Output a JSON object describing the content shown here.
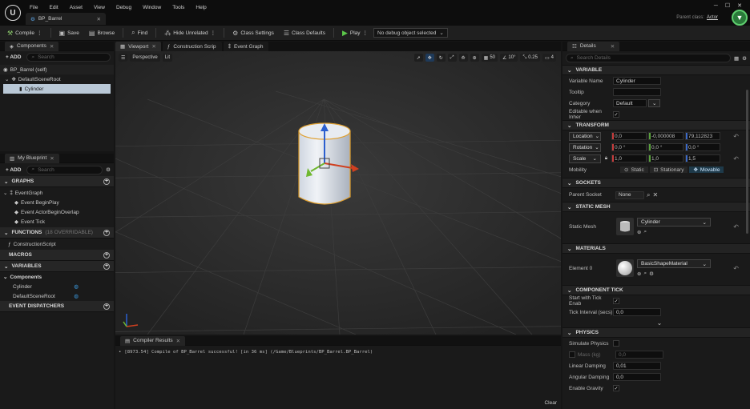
{
  "menu": [
    "File",
    "Edit",
    "Asset",
    "View",
    "Debug",
    "Window",
    "Tools",
    "Help"
  ],
  "tab": {
    "title": "BP_Barrel"
  },
  "window": {
    "parent_label": "Parent class:",
    "parent_value": "Actor"
  },
  "toolbar": {
    "compile": "Compile",
    "save": "Save",
    "browse": "Browse",
    "find": "Find",
    "hide_unrelated": "Hide Unrelated",
    "class_settings": "Class Settings",
    "class_defaults": "Class Defaults",
    "play": "Play",
    "debug_object": "No debug object selected"
  },
  "components": {
    "tab": "Components",
    "add": "+ ADD",
    "search_placeholder": "Search",
    "root": "BP_Barrel (self)",
    "scene_root": "DefaultSceneRoot",
    "cylinder": "Cylinder"
  },
  "myblueprint": {
    "tab": "My Blueprint",
    "add": "+ ADD",
    "search_placeholder": "Search",
    "graphs": "GRAPHS",
    "event_graph": "EventGraph",
    "events": [
      "Event BeginPlay",
      "Event ActorBeginOverlap",
      "Event Tick"
    ],
    "functions": "FUNCTIONS",
    "functions_sub": "(18 OVERRIDABLE)",
    "construction_script": "ConstructionScript",
    "macros": "MACROS",
    "variables": "VARIABLES",
    "components_group": "Components",
    "var_cylinder": "Cylinder",
    "var_scene_root": "DefaultSceneRoot",
    "dispatchers": "EVENT DISPATCHERS"
  },
  "editor_tabs": {
    "viewport": "Viewport",
    "construction": "Construction Scrip",
    "event_graph": "Event Graph"
  },
  "viewport": {
    "perspective": "Perspective",
    "lit": "Lit",
    "grid_snap": "50",
    "rot_snap": "10°",
    "scale_snap": "0.25",
    "cam_speed": "4"
  },
  "compiler": {
    "tab": "Compiler Results",
    "message": "[8973.54] Compile of BP_Barrel successful! [in 36 ms] (/Game/Blueprints/BP_Barrel.BP_Barrel)",
    "clear": "Clear"
  },
  "details": {
    "tab": "Details",
    "search_placeholder": "Search Details",
    "variable": {
      "header": "VARIABLE",
      "name_label": "Variable Name",
      "name_value": "Cylinder",
      "tooltip_label": "Tooltip",
      "tooltip_value": "",
      "category_label": "Category",
      "category_value": "Default",
      "editable_label": "Editable when Inher"
    },
    "transform": {
      "header": "TRANSFORM",
      "location": "Location",
      "rotation": "Rotation",
      "scale": "Scale",
      "loc": [
        "0,0",
        "-0,000008",
        "79,112823"
      ],
      "rot": [
        "0,0 °",
        "0,0 °",
        "0,0 °"
      ],
      "scl": [
        "1,0",
        "1,0",
        "1,5"
      ],
      "mobility": "Mobility",
      "static": "Static",
      "stationary": "Stationary",
      "movable": "Movable"
    },
    "sockets": {
      "header": "SOCKETS",
      "parent_label": "Parent Socket",
      "parent_value": "None"
    },
    "static_mesh": {
      "header": "STATIC MESH",
      "label": "Static Mesh",
      "value": "Cylinder"
    },
    "materials": {
      "header": "MATERIALS",
      "label": "Element 0",
      "value": "BasicShapeMaterial"
    },
    "component_tick": {
      "header": "COMPONENT TICK",
      "start_label": "Start with Tick Enab",
      "interval_label": "Tick Interval (secs)",
      "interval_value": "0,0"
    },
    "physics": {
      "header": "PHYSICS",
      "simulate": "Simulate Physics",
      "mass": "Mass (kg)",
      "mass_value": "0,0",
      "linear": "Linear Damping",
      "linear_value": "0,01",
      "angular": "Angular Damping",
      "angular_value": "0,0",
      "gravity": "Enable Gravity"
    }
  },
  "colors": {
    "accent": "#d8a838",
    "play": "#5cc84a",
    "selected_row": "#b9c8d6"
  }
}
